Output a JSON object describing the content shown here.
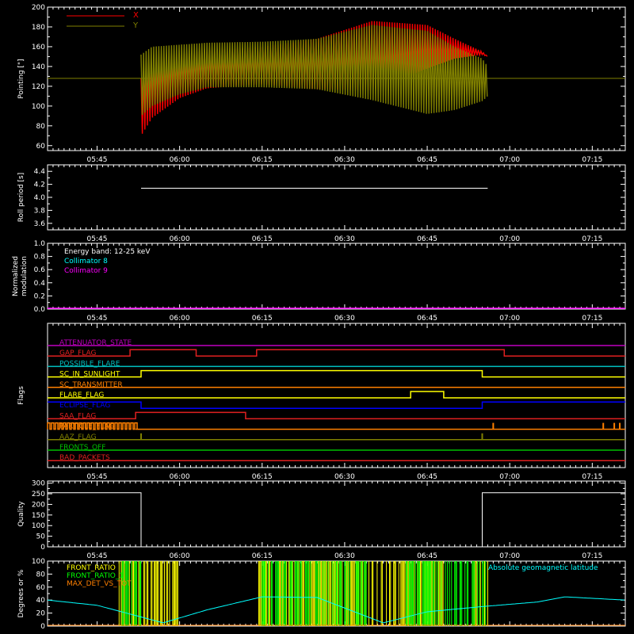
{
  "colors": {
    "background": "#000000",
    "axes": "#ffffff",
    "x_pointing": "#ff0000",
    "y_pointing": "#808000",
    "roll": "#ffffff",
    "collimator8": "#00ffff",
    "collimator9": "#ff00ff",
    "front_ratio": "#ffff00",
    "front_ratio_alt": "#00ff00",
    "max_det_vs_tot": "#ff8000",
    "geomag": "#00ffff"
  },
  "time_axis": {
    "unit": "HH:MM",
    "range": [
      "05:36",
      "07:21"
    ],
    "ticks": [
      "05:45",
      "06:00",
      "06:15",
      "06:30",
      "06:45",
      "07:00",
      "07:15"
    ]
  },
  "chart_data": [
    {
      "type": "line",
      "ylabel": "Pointing [\"]",
      "ylim": [
        55,
        200
      ],
      "yticks": [
        60,
        80,
        100,
        120,
        140,
        160,
        180,
        200
      ],
      "legend": {
        "placement": "top-left",
        "entries": [
          "X",
          "Y"
        ]
      },
      "series": [
        {
          "name": "X",
          "x": [
            "05:53",
            "05:55",
            "06:00",
            "06:05",
            "06:15",
            "06:25",
            "06:35",
            "06:45",
            "06:50",
            "06:55",
            "06:56"
          ],
          "upper": [
            128,
            148,
            152,
            156,
            160,
            168,
            186,
            182,
            168,
            155,
            150
          ],
          "lower": [
            70,
            88,
            108,
            118,
            122,
            117,
            116,
            138,
            148,
            152,
            150
          ]
        },
        {
          "name": "Y",
          "x": [
            "05:53",
            "05:55",
            "06:00",
            "06:05",
            "06:15",
            "06:25",
            "06:35",
            "06:45",
            "06:50",
            "06:55",
            "06:56"
          ],
          "upper": [
            152,
            160,
            162,
            164,
            165,
            168,
            182,
            176,
            160,
            148,
            140
          ],
          "lower": [
            90,
            100,
            112,
            119,
            119,
            117,
            106,
            92,
            96,
            105,
            110
          ],
          "baseline": 128
        }
      ]
    },
    {
      "type": "line",
      "ylabel": "Roll period [s]",
      "ylim": [
        3.5,
        4.5
      ],
      "yticks": [
        3.6,
        3.8,
        4.0,
        4.2,
        4.4
      ],
      "series": [
        {
          "name": "",
          "x": [
            "05:53",
            "06:00",
            "06:15",
            "06:30",
            "06:45",
            "06:56"
          ],
          "y": [
            4.14,
            4.14,
            4.14,
            4.14,
            4.14,
            4.14
          ]
        }
      ]
    },
    {
      "type": "line",
      "ylabel": "Normalized modulation",
      "ylim": [
        0,
        1
      ],
      "yticks": [
        0.0,
        0.2,
        0.4,
        0.6,
        0.8,
        1.0
      ],
      "annotations": [
        "Energy band: 12-25 keV"
      ],
      "series": [
        {
          "name": "Collimator 8",
          "x": [
            "05:36",
            "07:21"
          ],
          "y": [
            0,
            0
          ]
        },
        {
          "name": "Collimator 9",
          "x": [
            "05:36",
            "07:21"
          ],
          "y": [
            0,
            0
          ]
        }
      ]
    },
    {
      "type": "line",
      "ylabel": "Flags",
      "series": [
        {
          "name": "ATTENUATOR_STATE",
          "color": "#c000c0",
          "states": [
            [
              "05:36",
              0
            ]
          ]
        },
        {
          "name": "GAP_FLAG",
          "color": "#e02020",
          "states": [
            [
              "05:36",
              0
            ],
            [
              "05:51",
              1
            ],
            [
              "06:03",
              0
            ],
            [
              "06:14",
              1
            ],
            [
              "06:59",
              0
            ]
          ]
        },
        {
          "name": "POSSIBLE_FLARE",
          "color": "#00c0c0",
          "states": [
            [
              "05:36",
              0
            ]
          ]
        },
        {
          "name": "SC_IN_SUNLIGHT",
          "color": "#ffff00",
          "states": [
            [
              "05:36",
              0
            ],
            [
              "05:53",
              1
            ],
            [
              "06:55",
              0
            ]
          ]
        },
        {
          "name": "SC_TRANSMITTER",
          "color": "#ff8000",
          "states": [
            [
              "05:36",
              0
            ]
          ]
        },
        {
          "name": "FLARE_FLAG",
          "color": "#ffff00",
          "states": [
            [
              "05:36",
              0
            ],
            [
              "06:42",
              1
            ],
            [
              "06:48",
              0
            ]
          ]
        },
        {
          "name": "ECLIPSE_FLAG",
          "color": "#0000ff",
          "states": [
            [
              "05:36",
              1
            ],
            [
              "05:53",
              0
            ],
            [
              "06:55",
              1
            ]
          ]
        },
        {
          "name": "SAA_FLAG",
          "color": "#e02020",
          "states": [
            [
              "05:36",
              0
            ],
            [
              "05:52",
              1
            ],
            [
              "06:12",
              0
            ]
          ]
        },
        {
          "name": "PARTICLE_FLAG",
          "color": "#ff8000",
          "states": [
            [
              "05:36",
              1
            ],
            [
              "05:52",
              0
            ]
          ],
          "spikes": [
            "06:57",
            "07:17",
            "07:19",
            "07:20"
          ]
        },
        {
          "name": "AAZ_FLAG",
          "color": "#808000",
          "states": [
            [
              "05:36",
              0
            ]
          ],
          "spikes": [
            "05:53",
            "06:55"
          ]
        },
        {
          "name": "FRONTS_OFF",
          "color": "#00c000",
          "states": [
            [
              "05:36",
              0
            ]
          ]
        },
        {
          "name": "BAD_PACKETS",
          "color": "#e02020",
          "states": [
            [
              "05:36",
              0
            ]
          ]
        }
      ]
    },
    {
      "type": "line",
      "ylabel": "Quality",
      "ylim": [
        0,
        310
      ],
      "yticks": [
        0,
        50,
        100,
        150,
        200,
        250,
        300
      ],
      "series": [
        {
          "name": "",
          "x": [
            "05:36",
            "05:53",
            "05:53",
            "06:55",
            "06:55",
            "07:21"
          ],
          "y": [
            255,
            255,
            0,
            0,
            255,
            255
          ]
        }
      ]
    },
    {
      "type": "line",
      "ylabel": "Degrees or %",
      "ylim": [
        0,
        100
      ],
      "yticks": [
        0,
        20,
        40,
        60,
        80,
        100
      ],
      "legend": {
        "placement": "top-left",
        "entries": [
          "FRONT_RATIO",
          "FRONT_RATIO_1",
          "MAX_DET_VS_TOT"
        ]
      },
      "annotations": [
        "Absolute geomagnetic latitude"
      ],
      "series": [
        {
          "name": "FRONT_RATIO",
          "segments": [
            [
              "05:49",
              "06:00"
            ],
            [
              "06:14",
              "06:48"
            ],
            [
              "06:53",
              "06:56"
            ]
          ]
        },
        {
          "name": "FRONT_RATIO_1",
          "segments": [
            [
              "05:49",
              "05:53"
            ],
            [
              "06:15",
              "06:34"
            ],
            [
              "06:41",
              "06:56"
            ]
          ]
        },
        {
          "name": "MAX_DET_VS_TOT",
          "x": [
            "05:36",
            "07:21"
          ],
          "y": [
            0,
            0
          ]
        },
        {
          "name": "Absolute geomagnetic latitude",
          "x": [
            "05:36",
            "05:45",
            "05:57",
            "06:05",
            "06:15",
            "06:25",
            "06:37",
            "06:45",
            "06:55",
            "07:05",
            "07:10",
            "07:21"
          ],
          "y": [
            40,
            32,
            5,
            25,
            45,
            44,
            5,
            22,
            30,
            37,
            45,
            40
          ]
        }
      ]
    }
  ]
}
